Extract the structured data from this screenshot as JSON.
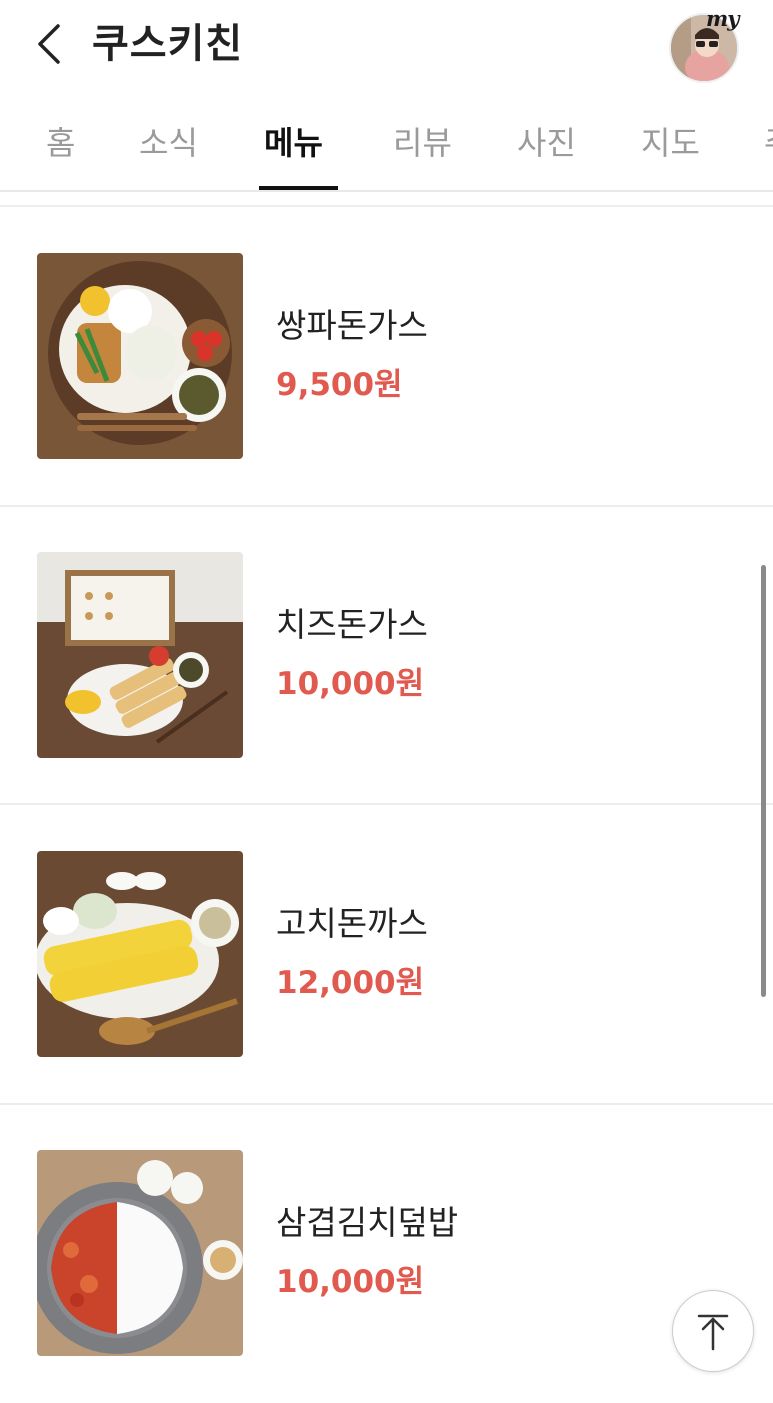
{
  "header": {
    "title": "쿠스키친",
    "back_icon": "chevron-left-icon",
    "avatar_badge": "my"
  },
  "tabs": [
    {
      "label": "홈",
      "active": false
    },
    {
      "label": "소식",
      "active": false
    },
    {
      "label": "메뉴",
      "active": true
    },
    {
      "label": "리뷰",
      "active": false
    },
    {
      "label": "사진",
      "active": false
    },
    {
      "label": "지도",
      "active": false
    },
    {
      "label": "주",
      "active": false
    }
  ],
  "menu": {
    "items": [
      {
        "name": "쌍파돈가스",
        "price": "9,500원"
      },
      {
        "name": "치즈돈가스",
        "price": "10,000원"
      },
      {
        "name": "고치돈까스",
        "price": "12,000원"
      },
      {
        "name": "삼겹김치덮밥",
        "price": "10,000원"
      }
    ]
  },
  "colors": {
    "price": "#e05a4f",
    "active_tab": "#111111",
    "inactive_tab": "#9a9a9a"
  },
  "scroll_top_icon": "arrow-up-icon"
}
